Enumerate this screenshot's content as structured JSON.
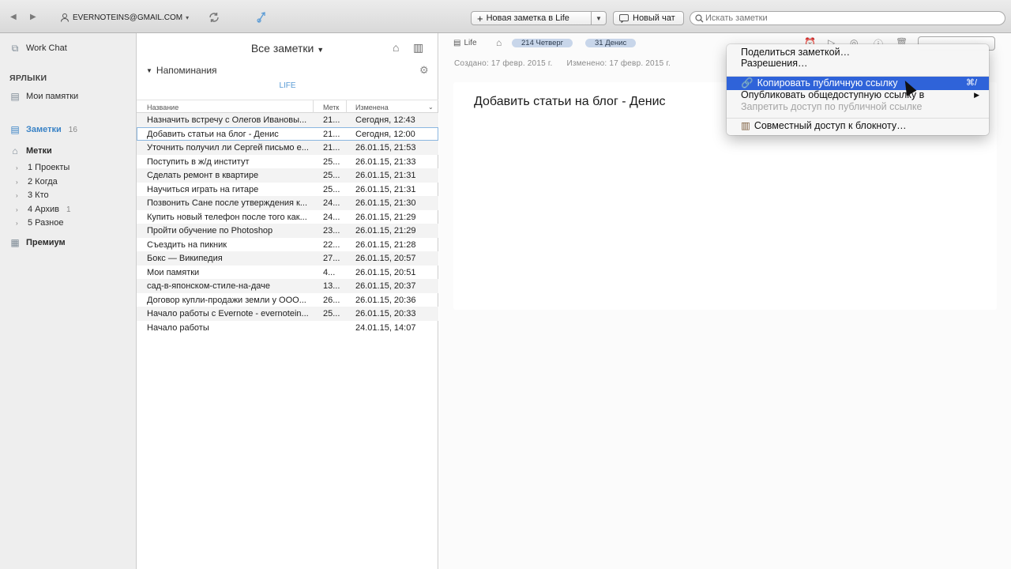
{
  "toolbar": {
    "back_icon": "◀",
    "forward_icon": "▶",
    "account": "EVERNOTEINS@GMAIL.COM",
    "new_note_label": "Новая заметка в Life",
    "new_chat_label": "Новый чат",
    "search_placeholder": "Искать заметки"
  },
  "sidebar": {
    "work_chat": "Work Chat",
    "shortcuts_header": "ЯРЛЫКИ",
    "shortcut_item": "Мои памятки",
    "notes_label": "Заметки",
    "notes_count": "16",
    "tags_label": "Метки",
    "tags": [
      {
        "label": "1 Проекты",
        "count": ""
      },
      {
        "label": "2 Когда",
        "count": ""
      },
      {
        "label": "3 Кто",
        "count": ""
      },
      {
        "label": "4 Архив",
        "count": "1"
      },
      {
        "label": "5 Разное",
        "count": ""
      }
    ],
    "premium": "Премиум"
  },
  "notelist": {
    "title": "Все заметки",
    "reminders": "Напоминания",
    "life_tab": "LIFE",
    "columns": {
      "name": "Название",
      "tag": "Метк",
      "modified": "Изменена"
    },
    "rows": [
      {
        "name": "Назначить встречу с Олегов Ивановы...",
        "tag": "21...",
        "date": "Сегодня, 12:43"
      },
      {
        "name": "Добавить статьи на блог - Денис",
        "tag": "21...",
        "date": "Сегодня, 12:00"
      },
      {
        "name": "Уточнить получил ли Сергей письмо е...",
        "tag": "21...",
        "date": "26.01.15, 21:53"
      },
      {
        "name": "Поступить в ж/д институт",
        "tag": "25...",
        "date": "26.01.15, 21:33"
      },
      {
        "name": "Сделать ремонт в квартире",
        "tag": "25...",
        "date": "26.01.15, 21:31"
      },
      {
        "name": "Научиться играть на гитаре",
        "tag": "25...",
        "date": "26.01.15, 21:31"
      },
      {
        "name": "Позвонить Сане после утверждения к...",
        "tag": "24...",
        "date": "26.01.15, 21:30"
      },
      {
        "name": "Купить новый телефон после того как...",
        "tag": "24...",
        "date": "26.01.15, 21:29"
      },
      {
        "name": "Пройти обучение по Photoshop",
        "tag": "23...",
        "date": "26.01.15, 21:29"
      },
      {
        "name": "Съездить на пикник",
        "tag": "22...",
        "date": "26.01.15, 21:28"
      },
      {
        "name": "Бокс — Википедия",
        "tag": "27...",
        "date": "26.01.15, 20:57"
      },
      {
        "name": "Мои памятки",
        "tag": "4...",
        "date": "26.01.15, 20:51"
      },
      {
        "name": "сад-в-японском-стиле-на-даче",
        "tag": "13...",
        "date": "26.01.15, 20:37"
      },
      {
        "name": "Договор купли-продажи земли у ООО...",
        "tag": "26...",
        "date": "26.01.15, 20:36"
      },
      {
        "name": "Начало работы с Evernote - evernotein...",
        "tag": "25...",
        "date": "26.01.15, 20:33"
      },
      {
        "name": "Начало работы",
        "tag": "",
        "date": "24.01.15, 14:07"
      }
    ]
  },
  "editor": {
    "notebook": "Life",
    "tags": [
      "214 Четверг",
      "31 Денис"
    ],
    "created": "Создано: 17 февр. 2015 г.",
    "modified": "Изменено: 17 февр. 2015 г.",
    "title": "Добавить статьи на блог - Денис"
  },
  "menu": {
    "items": [
      {
        "label": "Поделиться заметкой…"
      },
      {
        "label": "Разрешения…"
      },
      {
        "label": "Копировать публичную ссылку",
        "shortcut": "⌘/"
      },
      {
        "label": "Опубликовать общедоступную ссылку в"
      },
      {
        "label": "Запретить доступ по публичной ссылке"
      },
      {
        "label": "Совместный доступ к блокноту…"
      }
    ]
  },
  "colors": {
    "accent": "#2f63d9",
    "sidebar_blue": "#3a83c6"
  }
}
